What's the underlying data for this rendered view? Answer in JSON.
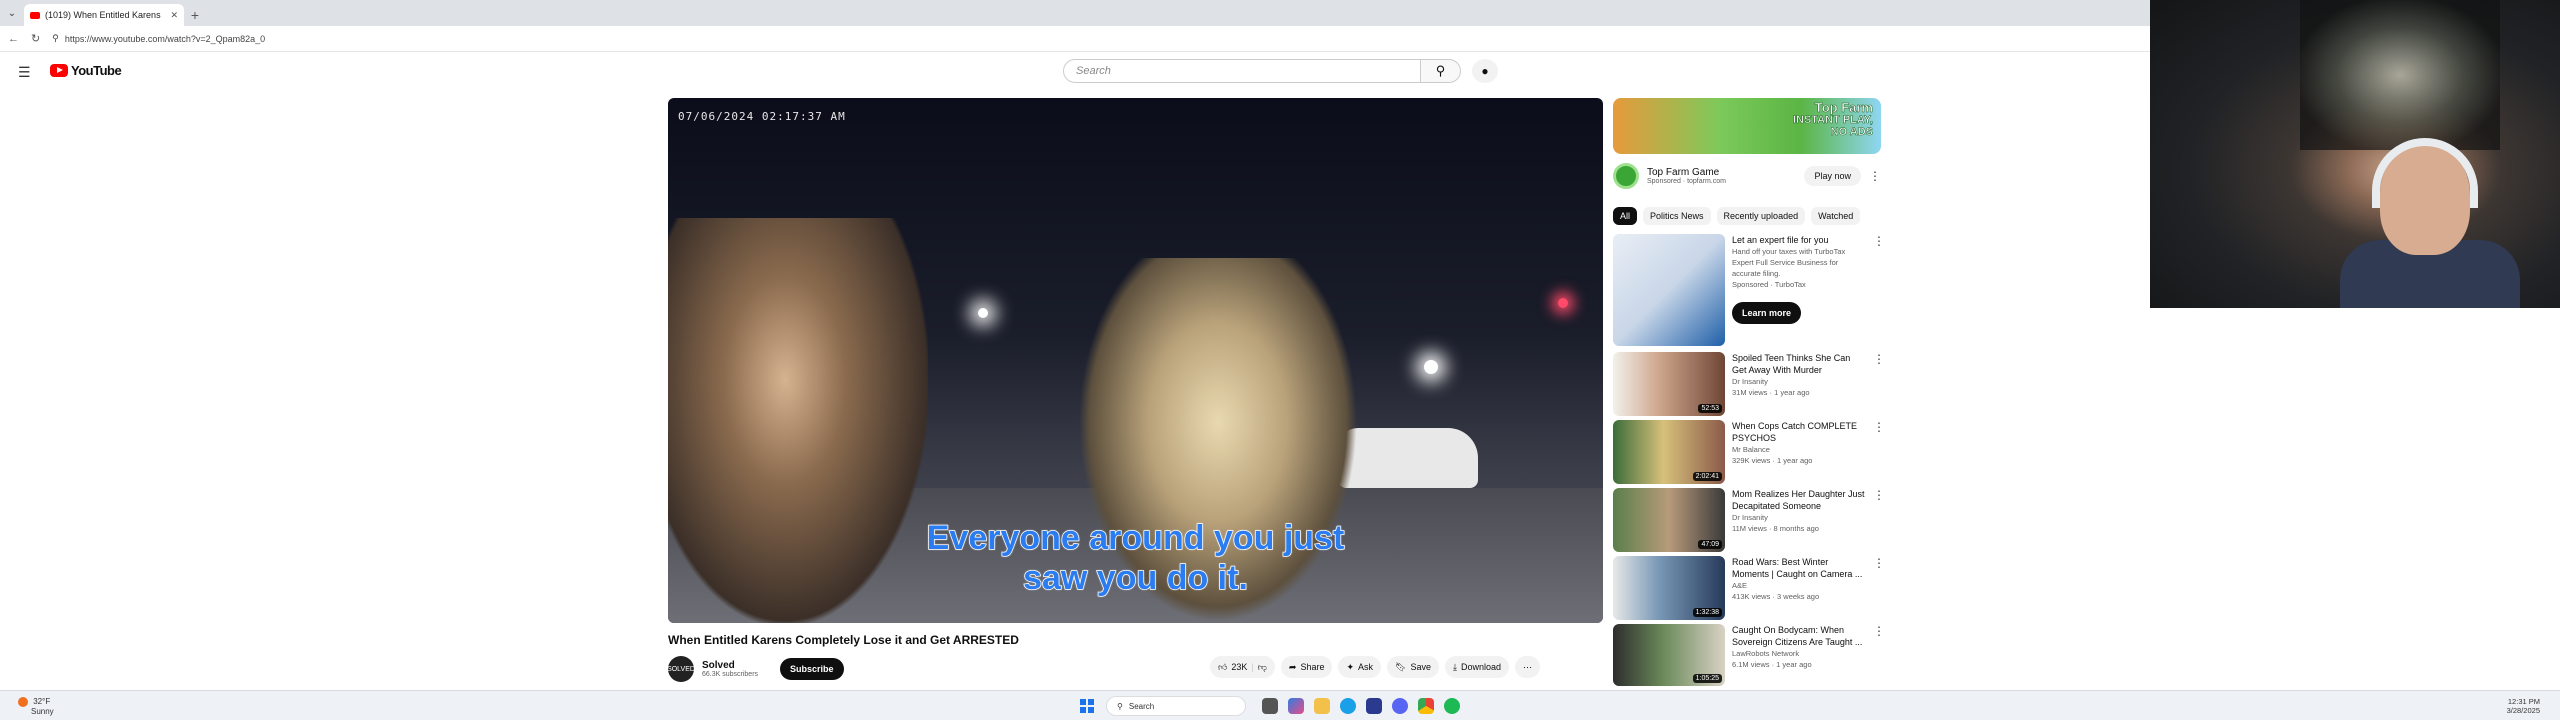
{
  "browser": {
    "tab_title": "(1019) When Entitled Karens",
    "tab_close": "✕",
    "new_tab": "+",
    "url": "https://www.youtube.com/watch?v=2_Qpam82a_0"
  },
  "youtube": {
    "logo_text": "YouTube",
    "search_placeholder": "Search",
    "video": {
      "timestamp": "07/06/2024 02:17:37 AM",
      "caption_line1": "Everyone around you just",
      "caption_line2": "saw you do it.",
      "title": "When Entitled Karens Completely Lose it and Get ARRESTED",
      "channel_avatar": "SOLVED",
      "channel_name": "Solved",
      "subscribers": "66.3K subscribers",
      "subscribe_label": "Subscribe",
      "likes": "23K",
      "share_label": "Share",
      "ask_label": "Ask",
      "save_label": "Save",
      "download_label": "Download"
    },
    "ad": {
      "banner_line1": "INSTANT PLAY,",
      "banner_line2": "NO ADS",
      "banner_brand": "Top Farm",
      "name": "Top Farm Game",
      "sponsored": "Sponsored · topfarm.com",
      "cta": "Play now"
    },
    "chips": [
      "All",
      "Politics News",
      "Recently uploaded",
      "Watched"
    ],
    "recommendations": [
      {
        "title": "Let an expert file for you",
        "line2": "Hand off your taxes with TurboTax Expert Full Service Business for accurate filing.",
        "line3": "Sponsored · TurboTax",
        "cta": "Learn more",
        "duration": ""
      },
      {
        "title": "Spoiled Teen Thinks She Can Get Away With Murder",
        "line2": "Dr Insanity",
        "line3": "31M views · 1 year ago",
        "duration": "52:53"
      },
      {
        "title": "When Cops Catch COMPLETE PSYCHOS",
        "line2": "Mr Balance",
        "line3": "329K views · 1 year ago",
        "duration": "2:02:41"
      },
      {
        "title": "Mom Realizes Her Daughter Just Decapitated Someone",
        "line2": "Dr Insanity",
        "line3": "11M views · 8 months ago",
        "duration": "47:09"
      },
      {
        "title": "Road Wars: Best Winter Moments | Caught on Camera ...",
        "line2": "A&E",
        "line3": "413K views · 3 weeks ago",
        "duration": "1:32:38"
      },
      {
        "title": "Caught On Bodycam: When Sovereign Citizens Are Taught ...",
        "line2": "LawRobots Network",
        "line3": "6.1M views · 1 year ago",
        "duration": "1:05:25"
      }
    ]
  },
  "taskbar": {
    "temp": "32°F",
    "condition": "Sunny",
    "search": "Search",
    "time": "12:31 PM",
    "date": "3/28/2025"
  },
  "colors": {
    "youtube_red": "#ff0000",
    "caption_blue": "#2a7cf0",
    "windows_blue": "#1a73e8"
  }
}
